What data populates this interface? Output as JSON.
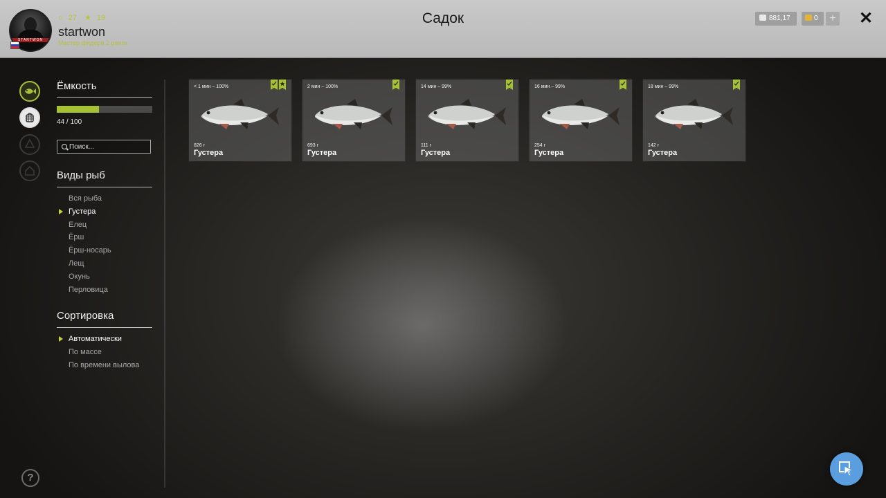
{
  "header": {
    "title": "Садок",
    "avatar_text": "STARTWON",
    "username": "startwon",
    "rank": "Мастер фидера 2 ранга",
    "level_a": "27",
    "level_b": "19",
    "silver": "881,17",
    "gold": "0",
    "add_label": "+",
    "close_label": "✕"
  },
  "side_icons": [
    "fish-icon",
    "keepnet-icon",
    "boat-icon",
    "house-icon"
  ],
  "capacity": {
    "title": "Ёмкость",
    "current": 44,
    "max": 100,
    "text": "44 / 100",
    "fill_fraction": 0.44
  },
  "search": {
    "placeholder": "Поиск..."
  },
  "species": {
    "title": "Виды рыб",
    "items": [
      "Вся рыба",
      "Густера",
      "Елец",
      "Ёрш",
      "Ёрш-носарь",
      "Лещ",
      "Окунь",
      "Перловица"
    ],
    "selected": "Густера"
  },
  "sort": {
    "title": "Сортировка",
    "items": [
      "Автоматически",
      "По массе",
      "По времени вылова"
    ],
    "selected": "Автоматически"
  },
  "cards": [
    {
      "time": "< 1 мин – 100%",
      "weight": "826 г",
      "name": "Густера",
      "badges": 2
    },
    {
      "time": "2 мин – 100%",
      "weight": "693 г",
      "name": "Густера",
      "badges": 1
    },
    {
      "time": "14 мин – 99%",
      "weight": "111 г",
      "name": "Густера",
      "badges": 1
    },
    {
      "time": "16 мин – 99%",
      "weight": "254 г",
      "name": "Густера",
      "badges": 1
    },
    {
      "time": "18 мин – 99%",
      "weight": "142 г",
      "name": "Густера",
      "badges": 1
    }
  ],
  "help_label": "?",
  "colors": {
    "accent": "#a6c232",
    "cursor_button": "#5a9ee0"
  }
}
